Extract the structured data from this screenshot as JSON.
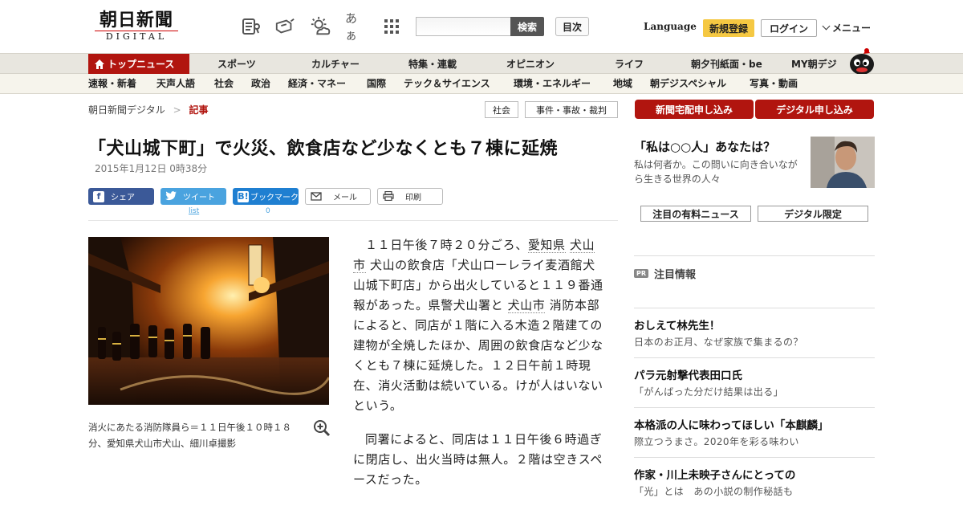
{
  "header": {
    "logo_main": "朝日新聞",
    "logo_sub": "DIGITAL",
    "icons": [
      "newspaper-icon",
      "megaphone-icon",
      "weather-icon",
      "font-size-icon",
      "grid-menu-icon"
    ],
    "font_size_glyph": "あぁ",
    "search_placeholder": "",
    "search_button": "検索",
    "mokuji_button": "目次",
    "language": "Language",
    "register": "新規登録",
    "login": "ログイン",
    "menu": "メニュー"
  },
  "nav_main": {
    "active": "トップニュース",
    "items": [
      "スポーツ",
      "カルチャー",
      "特集・連載",
      "オピニオン",
      "ライフ",
      "朝夕刊紙面・be",
      "MY朝デジ"
    ]
  },
  "nav_sub": {
    "items": [
      "速報・新着",
      "天声人語",
      "社会",
      "政治",
      "経済・マネー",
      "国際",
      "テック＆サイエンス",
      "環境・エネルギー",
      "地域",
      "朝デジスペシャル",
      "写真・動画"
    ]
  },
  "breadcrumb": {
    "root": "朝日新聞デジタル",
    "sep": ">",
    "current": "記事"
  },
  "tags": [
    "社会",
    "事件・事故・裁判"
  ],
  "article": {
    "headline": "「犬山城下町」で火災、飲食店など少なくとも７棟に延焼",
    "date": "2015年1月12日 0時38分",
    "share": {
      "facebook": "シェア",
      "twitter": "ツイート",
      "hatena": "ブックマーク",
      "mail": "メール",
      "print": "印刷",
      "twitter_count": "list",
      "hatena_count": "0"
    },
    "photo_caption": "消火にあたる消防隊員ら＝１１日午後１０時１８分、愛知県犬山市犬山、細川卓撮影",
    "p1_a": "１１日午後７時２０分ごろ、",
    "p1_kw1": "愛知県",
    "p1_kw2": "犬山市",
    "p1_b": "犬山の飲食店「犬山ローレライ麦酒館犬山城下町店」から出火していると１１９番通報があった。県警犬山署と",
    "p1_kw3": "犬山市",
    "p1_c": "消防本部によると、同店が１階に入る木造２階建ての建物が全焼したほか、周囲の飲食店など少なくとも７棟に延焼した。１２日午前１時現在、消火活動は続いている。けが人はいないという。",
    "p2": "同署によると、同店は１１日午後６時過ぎに閉店し、出火当時は無人。２階は空きスペースだった。"
  },
  "sidebar": {
    "promo_newspaper": "新聞宅配申し込み",
    "promo_digital": "デジタル申し込み",
    "feature_title": "「私は○○人」あなたは？",
    "feature_desc": "私は何者か。この問いに向き合いながら生きる世界の人々",
    "tab_paid": "注目の有料ニュース",
    "tab_digital": "デジタル限定",
    "pr_badge": "PR",
    "pr_title": "注目情報",
    "items": [
      {
        "title": "おしえて林先生！",
        "sub": "日本のお正月、なぜ家族で集まるの？"
      },
      {
        "title": "パラ元射撃代表田口氏",
        "sub": "「がんばった分だけ結果は出る」"
      },
      {
        "title": "本格派の人に味わってほしい「本麒麟」",
        "sub": "際立つうまさ。2020年を彩る味わい"
      },
      {
        "title": "作家・川上未映子さんにとっての",
        "sub": "「光」とは　あの小説の制作秘話も"
      }
    ]
  },
  "colors": {
    "brand_red": "#b1150f",
    "nav_bg": "#e8e6df",
    "register_yellow": "#f5c842",
    "facebook": "#3b5998",
    "twitter": "#4aa3df",
    "hatena": "#1f7fd1"
  }
}
